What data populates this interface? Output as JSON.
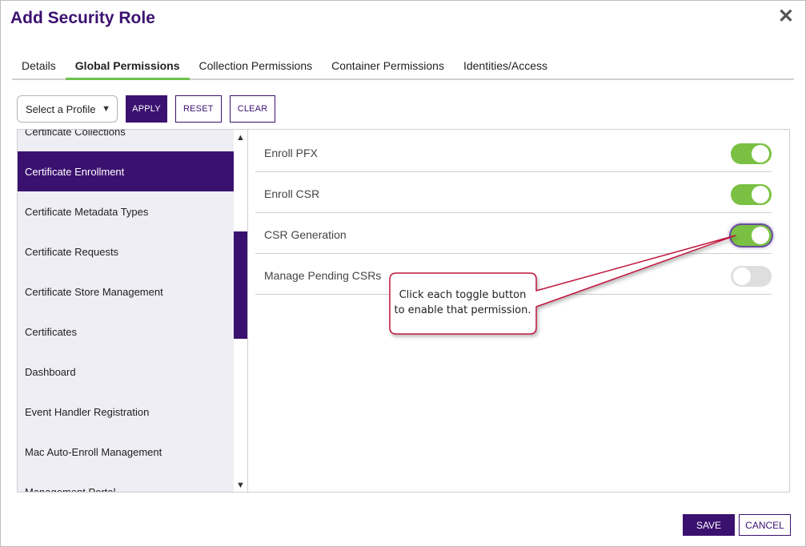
{
  "dialog": {
    "title": "Add Security Role",
    "close_icon": "close-icon"
  },
  "tabs": [
    {
      "label": "Details",
      "active": false
    },
    {
      "label": "Global Permissions",
      "active": true
    },
    {
      "label": "Collection Permissions",
      "active": false
    },
    {
      "label": "Container Permissions",
      "active": false
    },
    {
      "label": "Identities/Access",
      "active": false
    }
  ],
  "toolbar": {
    "profile_select": "Select a Profile",
    "apply_label": "APPLY",
    "reset_label": "RESET",
    "clear_label": "CLEAR"
  },
  "categories": [
    {
      "label": "Certificate Collections",
      "active": false
    },
    {
      "label": "Certificate Enrollment",
      "active": true
    },
    {
      "label": "Certificate Metadata Types",
      "active": false
    },
    {
      "label": "Certificate Requests",
      "active": false
    },
    {
      "label": "Certificate Store Management",
      "active": false
    },
    {
      "label": "Certificates",
      "active": false
    },
    {
      "label": "Dashboard",
      "active": false
    },
    {
      "label": "Event Handler Registration",
      "active": false
    },
    {
      "label": "Mac Auto-Enroll Management",
      "active": false
    },
    {
      "label": "Management Portal",
      "active": false
    }
  ],
  "permissions": [
    {
      "label": "Enroll PFX",
      "enabled": true
    },
    {
      "label": "Enroll CSR",
      "enabled": true
    },
    {
      "label": "CSR Generation",
      "enabled": true
    },
    {
      "label": "Manage Pending CSRs",
      "enabled": false
    }
  ],
  "callout": {
    "line1": "Click each toggle button",
    "line2": "to enable that permission."
  },
  "footer": {
    "save_label": "SAVE",
    "cancel_label": "CANCEL"
  },
  "colors": {
    "brand": "#3b1170",
    "toggle_on": "#7ac143",
    "callout_border": "#c0143c"
  }
}
